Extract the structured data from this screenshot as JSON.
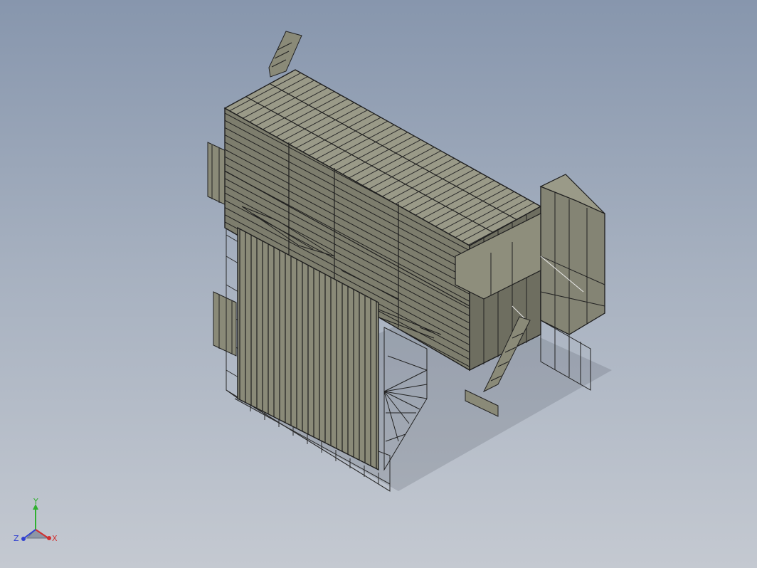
{
  "viewport": {
    "background_top": "#8796ad",
    "background_bottom": "#c4c9d1",
    "model": {
      "icon": "industrial-steel-structure-wireframe",
      "fill_color": "#8a8a7a",
      "edge_color": "#2a2a2a"
    }
  },
  "triad": {
    "x_label": "X",
    "y_label": "Y",
    "z_label": "Z",
    "x_color": "#d03030",
    "y_color": "#30b030",
    "z_color": "#3040d0"
  }
}
